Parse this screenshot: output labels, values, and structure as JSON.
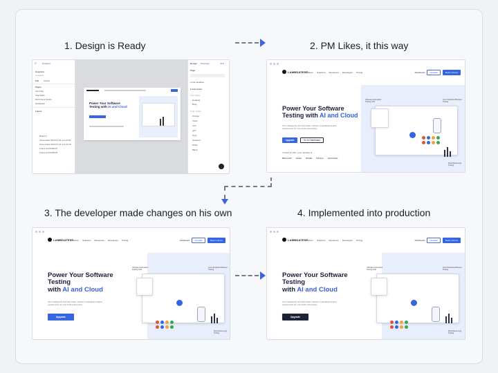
{
  "steps": [
    {
      "title": "1. Design is Ready"
    },
    {
      "title": "2. PM Likes, it this way"
    },
    {
      "title": "3. The developer made changes on his own"
    },
    {
      "title": "4. Implemented into production"
    }
  ],
  "site": {
    "brand": "LAMBDATEST",
    "nav": [
      "Platform",
      "Solutions",
      "Resources",
      "Developers",
      "Pricing"
    ],
    "dashboard": "Dashboard",
    "upgrade": "Upgrade",
    "book_demo": "Book a Demo",
    "hero_line1": "Power Your Software",
    "hero_line2": "Testing with",
    "hero_accent": "AI and Cloud",
    "hero_sub": "Test intelligently and ship faster. Deliver unparalleled digital experiences for real world enterprises.",
    "cta_primary": "Upgrade",
    "cta_secondary": "Go to Dashboard",
    "trusted": "Trusted by 2M+ users globally at",
    "customers": [
      "Microsoft",
      "vimeo",
      "Nvidia",
      "Infosys",
      "Accenture"
    ],
    "tags": {
      "left": "Ultimate Automation Testing Grid",
      "right": "Live Interactive Browser Testing",
      "bottom": "Real Device App Testing"
    }
  },
  "editor": {
    "file": "Graphics",
    "file_sub": "Unsaved",
    "tabs": [
      "File",
      "Assets"
    ],
    "pages_label": "Pages",
    "pages": [
      "Land Sig",
      "Standards",
      "Pitch Deck Studio",
      "Newsletter"
    ],
    "layers_label": "Layers",
    "layers": [
      "Board 2",
      "Screenshot 2023-07-19 at 4.23.01",
      "Screenshot 2023-07-19 at 4.23.15",
      "Frame 2147225237",
      "Frame 2147225278"
    ],
    "right_tabs": [
      "Design",
      "Prototype"
    ],
    "zoom": "47%",
    "page_label": "Page",
    "local_variables": "Local variables",
    "local_styles": "Local styles",
    "text_styles_label": "Text styles",
    "text_styles": [
      "Heading",
      "Body"
    ],
    "color_styles_label": "Color styles",
    "color_styles": [
      "Orange",
      "Violet",
      "nGT",
      "gGT",
      "Gray",
      "Graphics",
      "White",
      "Black"
    ]
  },
  "colors": {
    "accent": "#3565e0",
    "prod_button": "#1b2233",
    "arrow": "#3d63dd"
  }
}
